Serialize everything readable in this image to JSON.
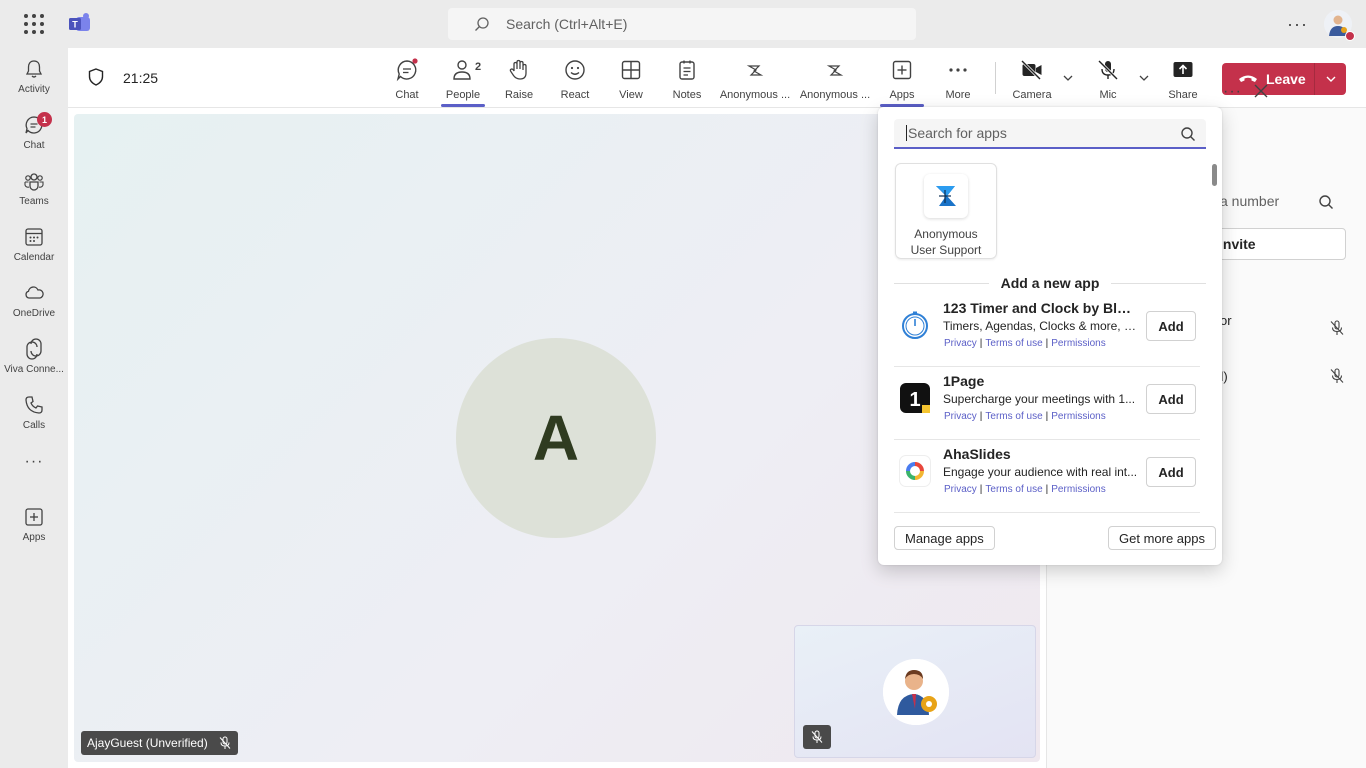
{
  "topbar": {
    "search_placeholder": "Search (Ctrl+Alt+E)",
    "more_label": "···"
  },
  "rail": {
    "items": [
      {
        "label": "Activity",
        "icon": "bell-icon"
      },
      {
        "label": "Chat",
        "icon": "chat-icon",
        "badge": "1"
      },
      {
        "label": "Teams",
        "icon": "teams-icon"
      },
      {
        "label": "Calendar",
        "icon": "calendar-icon"
      },
      {
        "label": "OneDrive",
        "icon": "onedrive-icon"
      },
      {
        "label": "Viva Conne...",
        "icon": "viva-icon"
      },
      {
        "label": "Calls",
        "icon": "phone-icon"
      },
      {
        "label": "Apps",
        "icon": "apps-icon"
      }
    ],
    "more_label": "···"
  },
  "meeting": {
    "timer": "21:25",
    "tools": [
      {
        "label": "Chat",
        "icon": "chat-icon"
      },
      {
        "label": "People",
        "icon": "people-icon",
        "count": "2"
      },
      {
        "label": "Raise",
        "icon": "raise-hand-icon"
      },
      {
        "label": "React",
        "icon": "react-icon"
      },
      {
        "label": "View",
        "icon": "view-icon"
      },
      {
        "label": "Notes",
        "icon": "notes-icon"
      },
      {
        "label": "Anonymous ...",
        "icon": "anonymous-app-icon"
      },
      {
        "label": "Anonymous ...",
        "icon": "anonymous-app-icon"
      },
      {
        "label": "Apps",
        "icon": "apps-icon"
      },
      {
        "label": "More",
        "icon": "more-icon"
      },
      {
        "label": "Camera",
        "icon": "camera-off-icon"
      },
      {
        "label": "Mic",
        "icon": "mic-off-icon"
      },
      {
        "label": "Share",
        "icon": "share-icon"
      }
    ],
    "leave_label": "Leave",
    "stage": {
      "avatar_initial": "A",
      "name_tag": "AjayGuest (Unverified)"
    }
  },
  "people_panel": {
    "search_partial": "a number",
    "invite_partial": "invite",
    "rows": [
      {
        "text": "or"
      },
      {
        "text": "ied)"
      }
    ]
  },
  "apps_flyout": {
    "search_placeholder": "Search for apps",
    "installed": [
      {
        "name_line1": "Anonymous",
        "name_line2": "User Support"
      }
    ],
    "add_header": "Add a new app",
    "apps": [
      {
        "name": "123 Timer and Clock by Blue...",
        "desc": "Timers, Agendas, Clocks & more, e...",
        "privacy": "Privacy",
        "terms": "Terms of use",
        "permissions": "Permissions",
        "add": "Add"
      },
      {
        "name": "1Page",
        "desc": "Supercharge your meetings with 1...",
        "privacy": "Privacy",
        "terms": "Terms of use",
        "permissions": "Permissions",
        "add": "Add"
      },
      {
        "name": "AhaSlides",
        "desc": "Engage your audience with real int...",
        "privacy": "Privacy",
        "terms": "Terms of use",
        "permissions": "Permissions",
        "add": "Add"
      }
    ],
    "manage_label": "Manage apps",
    "get_more_label": "Get more apps"
  },
  "colors": {
    "accent": "#5b5fc7",
    "leave": "#c4314b",
    "badge": "#c4314b"
  }
}
